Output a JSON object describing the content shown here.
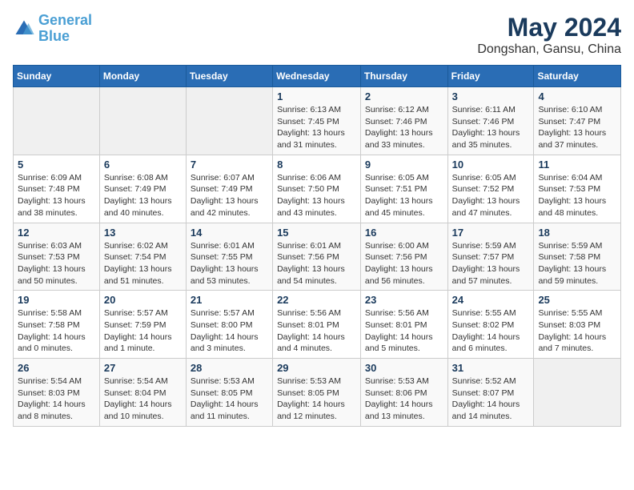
{
  "logo": {
    "line1": "General",
    "line2": "Blue"
  },
  "title": "May 2024",
  "location": "Dongshan, Gansu, China",
  "weekdays": [
    "Sunday",
    "Monday",
    "Tuesday",
    "Wednesday",
    "Thursday",
    "Friday",
    "Saturday"
  ],
  "weeks": [
    [
      {
        "day": "",
        "detail": ""
      },
      {
        "day": "",
        "detail": ""
      },
      {
        "day": "",
        "detail": ""
      },
      {
        "day": "1",
        "detail": "Sunrise: 6:13 AM\nSunset: 7:45 PM\nDaylight: 13 hours\nand 31 minutes."
      },
      {
        "day": "2",
        "detail": "Sunrise: 6:12 AM\nSunset: 7:46 PM\nDaylight: 13 hours\nand 33 minutes."
      },
      {
        "day": "3",
        "detail": "Sunrise: 6:11 AM\nSunset: 7:46 PM\nDaylight: 13 hours\nand 35 minutes."
      },
      {
        "day": "4",
        "detail": "Sunrise: 6:10 AM\nSunset: 7:47 PM\nDaylight: 13 hours\nand 37 minutes."
      }
    ],
    [
      {
        "day": "5",
        "detail": "Sunrise: 6:09 AM\nSunset: 7:48 PM\nDaylight: 13 hours\nand 38 minutes."
      },
      {
        "day": "6",
        "detail": "Sunrise: 6:08 AM\nSunset: 7:49 PM\nDaylight: 13 hours\nand 40 minutes."
      },
      {
        "day": "7",
        "detail": "Sunrise: 6:07 AM\nSunset: 7:49 PM\nDaylight: 13 hours\nand 42 minutes."
      },
      {
        "day": "8",
        "detail": "Sunrise: 6:06 AM\nSunset: 7:50 PM\nDaylight: 13 hours\nand 43 minutes."
      },
      {
        "day": "9",
        "detail": "Sunrise: 6:05 AM\nSunset: 7:51 PM\nDaylight: 13 hours\nand 45 minutes."
      },
      {
        "day": "10",
        "detail": "Sunrise: 6:05 AM\nSunset: 7:52 PM\nDaylight: 13 hours\nand 47 minutes."
      },
      {
        "day": "11",
        "detail": "Sunrise: 6:04 AM\nSunset: 7:53 PM\nDaylight: 13 hours\nand 48 minutes."
      }
    ],
    [
      {
        "day": "12",
        "detail": "Sunrise: 6:03 AM\nSunset: 7:53 PM\nDaylight: 13 hours\nand 50 minutes."
      },
      {
        "day": "13",
        "detail": "Sunrise: 6:02 AM\nSunset: 7:54 PM\nDaylight: 13 hours\nand 51 minutes."
      },
      {
        "day": "14",
        "detail": "Sunrise: 6:01 AM\nSunset: 7:55 PM\nDaylight: 13 hours\nand 53 minutes."
      },
      {
        "day": "15",
        "detail": "Sunrise: 6:01 AM\nSunset: 7:56 PM\nDaylight: 13 hours\nand 54 minutes."
      },
      {
        "day": "16",
        "detail": "Sunrise: 6:00 AM\nSunset: 7:56 PM\nDaylight: 13 hours\nand 56 minutes."
      },
      {
        "day": "17",
        "detail": "Sunrise: 5:59 AM\nSunset: 7:57 PM\nDaylight: 13 hours\nand 57 minutes."
      },
      {
        "day": "18",
        "detail": "Sunrise: 5:59 AM\nSunset: 7:58 PM\nDaylight: 13 hours\nand 59 minutes."
      }
    ],
    [
      {
        "day": "19",
        "detail": "Sunrise: 5:58 AM\nSunset: 7:58 PM\nDaylight: 14 hours\nand 0 minutes."
      },
      {
        "day": "20",
        "detail": "Sunrise: 5:57 AM\nSunset: 7:59 PM\nDaylight: 14 hours\nand 1 minute."
      },
      {
        "day": "21",
        "detail": "Sunrise: 5:57 AM\nSunset: 8:00 PM\nDaylight: 14 hours\nand 3 minutes."
      },
      {
        "day": "22",
        "detail": "Sunrise: 5:56 AM\nSunset: 8:01 PM\nDaylight: 14 hours\nand 4 minutes."
      },
      {
        "day": "23",
        "detail": "Sunrise: 5:56 AM\nSunset: 8:01 PM\nDaylight: 14 hours\nand 5 minutes."
      },
      {
        "day": "24",
        "detail": "Sunrise: 5:55 AM\nSunset: 8:02 PM\nDaylight: 14 hours\nand 6 minutes."
      },
      {
        "day": "25",
        "detail": "Sunrise: 5:55 AM\nSunset: 8:03 PM\nDaylight: 14 hours\nand 7 minutes."
      }
    ],
    [
      {
        "day": "26",
        "detail": "Sunrise: 5:54 AM\nSunset: 8:03 PM\nDaylight: 14 hours\nand 8 minutes."
      },
      {
        "day": "27",
        "detail": "Sunrise: 5:54 AM\nSunset: 8:04 PM\nDaylight: 14 hours\nand 10 minutes."
      },
      {
        "day": "28",
        "detail": "Sunrise: 5:53 AM\nSunset: 8:05 PM\nDaylight: 14 hours\nand 11 minutes."
      },
      {
        "day": "29",
        "detail": "Sunrise: 5:53 AM\nSunset: 8:05 PM\nDaylight: 14 hours\nand 12 minutes."
      },
      {
        "day": "30",
        "detail": "Sunrise: 5:53 AM\nSunset: 8:06 PM\nDaylight: 14 hours\nand 13 minutes."
      },
      {
        "day": "31",
        "detail": "Sunrise: 5:52 AM\nSunset: 8:07 PM\nDaylight: 14 hours\nand 14 minutes."
      },
      {
        "day": "",
        "detail": ""
      }
    ]
  ]
}
